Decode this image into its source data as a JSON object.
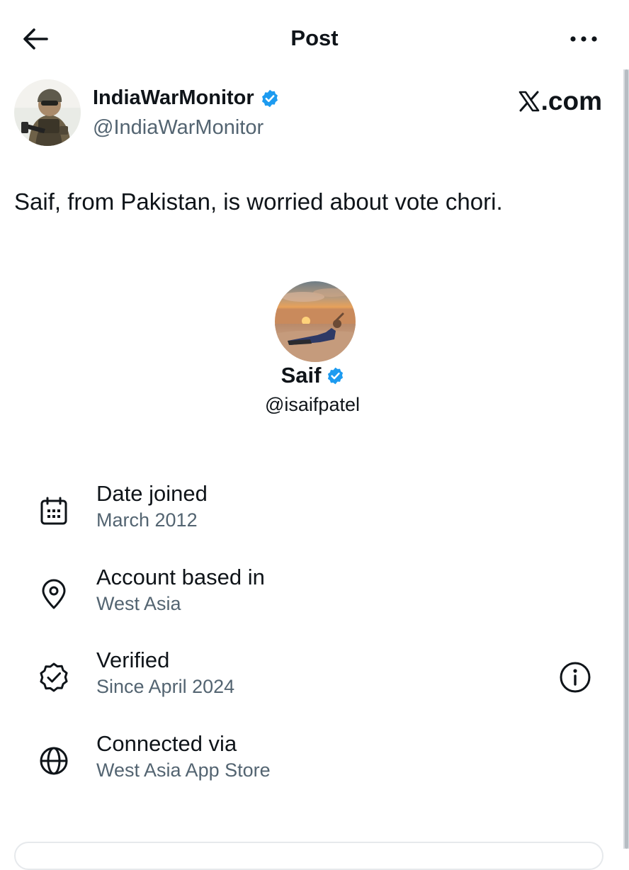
{
  "topbar": {
    "title": "Post",
    "back_icon": "arrow-left-icon",
    "more_icon": "more-horizontal-icon"
  },
  "author": {
    "name": "IndiaWarMonitor",
    "handle": "@IndiaWarMonitor",
    "verified": true,
    "avatar_icon": "soldier-avatar"
  },
  "brand": {
    "label": ".com",
    "logo_icon": "x-logo-icon"
  },
  "post": {
    "text": "Saif, from Pakistan, is worried about vote chori."
  },
  "profile_card": {
    "name": "Saif",
    "handle": "@isaifpatel",
    "verified": true,
    "avatar_icon": "desert-sunset-avatar",
    "details": [
      {
        "label": "Date joined",
        "value": "March 2012",
        "icon": "calendar-icon"
      },
      {
        "label": "Account based in",
        "value": "West Asia",
        "icon": "location-pin-icon"
      },
      {
        "label": "Verified",
        "value": "Since April 2024",
        "icon": "verified-badge-icon",
        "info_icon": "info-icon"
      },
      {
        "label": "Connected via",
        "value": "West Asia App Store",
        "icon": "globe-icon"
      }
    ]
  },
  "colors": {
    "text_primary": "#0f1419",
    "text_secondary": "#536471",
    "verified_blue": "#1d9bf0",
    "background": "#ffffff"
  }
}
